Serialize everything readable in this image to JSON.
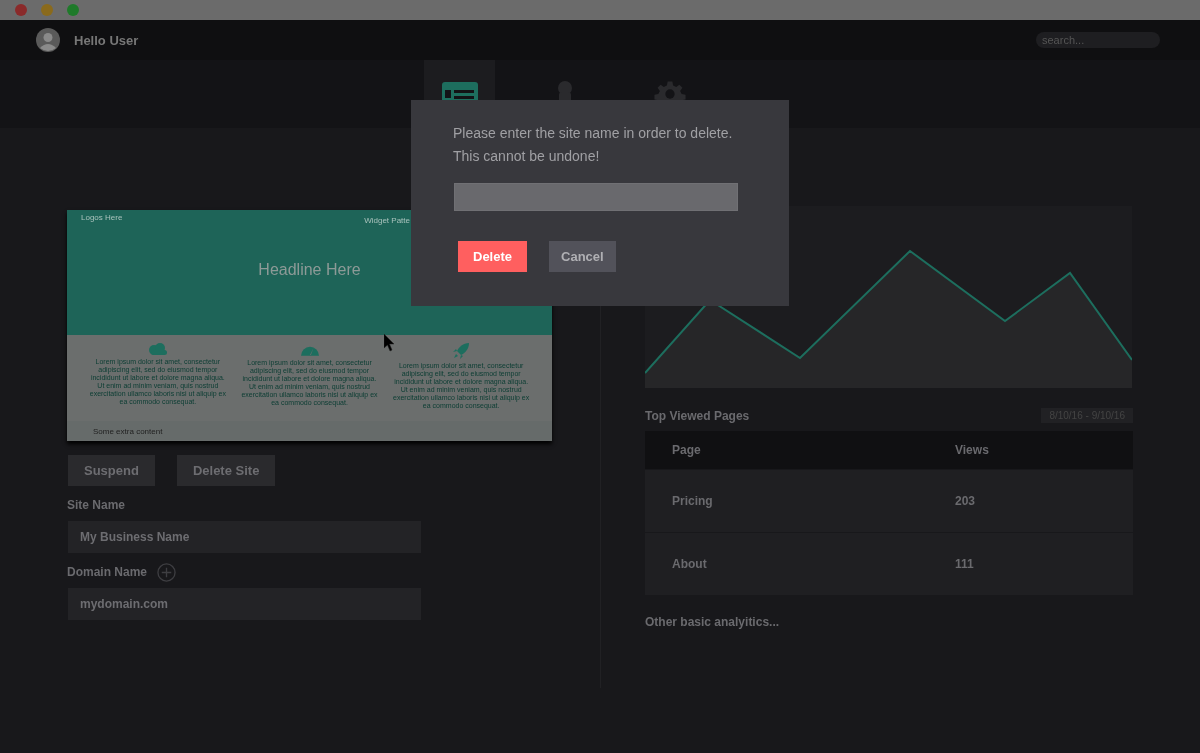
{
  "window": {
    "controls": [
      {
        "color": "#8a2a2a"
      },
      {
        "color": "#8a6a1c"
      },
      {
        "color": "#1f7a2a"
      }
    ]
  },
  "header": {
    "greeting": "Hello User",
    "search": {
      "placeholder": "search..."
    }
  },
  "nav": {
    "tabs": [
      {
        "kind": "site",
        "selected": true
      },
      {
        "kind": "user",
        "selected": false
      },
      {
        "kind": "settings",
        "selected": false
      }
    ]
  },
  "preview": {
    "logo": "Logos Here",
    "widget": "Widget Patte",
    "headline": "Headline Here",
    "features": [
      {
        "kind": "cloud",
        "text": "Lorem ipsum dolor sit amet, consectetur adipiscing elit, sed do eiusmod tempor incididunt ut labore et dolore magna aliqua. Ut enim ad minim veniam, quis nostrud exercitation ullamco laboris nisi ut aliquip ex ea commodo consequat."
      },
      {
        "kind": "gauge",
        "text": "Lorem ipsum dolor sit amet, consectetur adipiscing elit, sed do eiusmod tempor incididunt ut labore et dolore magna aliqua. Ut enim ad minim veniam, quis nostrud exercitation ullamco laboris nisi ut aliquip ex ea commodo consequat."
      },
      {
        "kind": "rocket",
        "text": "Lorem ipsum dolor sit amet, consectetur adipiscing elit, sed do eiusmod tempor incididunt ut labore et dolore magna aliqua. Ut enim ad minim veniam, quis nostrud exercitation ullamco laboris nisi ut aliquip ex ea commodo consequat."
      }
    ],
    "footer": "Some extra content"
  },
  "actions": [
    "Suspend",
    "Delete Site"
  ],
  "fields": [
    {
      "label": "Site Name",
      "value": "My Business Name"
    },
    {
      "label": "Domain Name",
      "value": "mydomain.com",
      "add": true
    }
  ],
  "analytics": {
    "title": "Top Viewed Pages",
    "date_range": "8/10/16 - 9/10/16",
    "columns": [
      "Page",
      "Views"
    ],
    "rows": [
      [
        "Pricing",
        "203"
      ],
      [
        "About",
        "111"
      ]
    ],
    "more": "Other basic analyitics..."
  },
  "dialog": {
    "message_lines": [
      "Please enter the site name in order to delete.",
      "This cannot be undone!"
    ],
    "buttons": [
      {
        "kind": "danger",
        "label": "Delete"
      },
      {
        "kind": "secondary",
        "label": "Cancel"
      }
    ]
  }
}
